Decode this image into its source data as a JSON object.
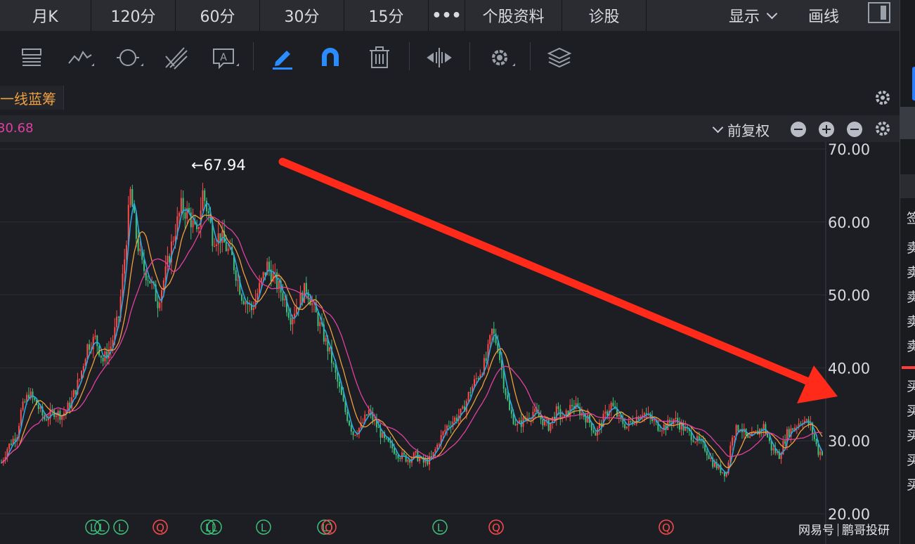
{
  "tabs": [
    "月K",
    "120分",
    "60分",
    "30分",
    "15分",
    "•••",
    "个股资料",
    "诊股"
  ],
  "display_label": "显示",
  "draw_label": "画线",
  "strategy_label": "一线蓝筹",
  "ma_value": "30.68",
  "price_adjust_label": "前复权",
  "peak_label": "←67.94",
  "watermark": {
    "brand": "网易号",
    "author": "鹏哥投研"
  },
  "edge_chars": [
    "签",
    "卖",
    "卖",
    "卖",
    "卖",
    "卖",
    "买",
    "买",
    "买",
    "买",
    "买"
  ],
  "colors": {
    "up": "#ff4a4a",
    "down": "#3fc07a",
    "ma5": "#29a8e0",
    "ma10": "#f0a040",
    "ma20": "#e040a0",
    "arrow": "#ff2a1a",
    "marker_q": "#ff4a4a",
    "marker_l": "#3fc07a"
  },
  "icons": [
    "text-list-icon",
    "polyline-icon",
    "cycle-icon",
    "fork-icon",
    "note-icon",
    "pencil-icon",
    "magnet-icon",
    "trash-icon",
    "split-icon",
    "settings-icon",
    "layers-icon"
  ],
  "chart_data": {
    "type": "candlestick",
    "ylim": [
      20,
      70
    ],
    "y_ticks": [
      "70.00",
      "60.00",
      "50.00",
      "40.00",
      "30.00",
      "20.00"
    ],
    "series": [
      {
        "name": "price",
        "points": [
          [
            0,
            27
          ],
          [
            3,
            29
          ],
          [
            8,
            31
          ],
          [
            10,
            34
          ],
          [
            14,
            36.5
          ],
          [
            18,
            35
          ],
          [
            22,
            33
          ],
          [
            27,
            34
          ],
          [
            31,
            33.5
          ],
          [
            35,
            35
          ],
          [
            40,
            38.5
          ],
          [
            44,
            43
          ],
          [
            48,
            44
          ],
          [
            52,
            41
          ],
          [
            56,
            43
          ],
          [
            60,
            47
          ],
          [
            63,
            55
          ],
          [
            66,
            64
          ],
          [
            69,
            58
          ],
          [
            72,
            54
          ],
          [
            76,
            52
          ],
          [
            80,
            49
          ],
          [
            84,
            53
          ],
          [
            88,
            58
          ],
          [
            92,
            62
          ],
          [
            96,
            61
          ],
          [
            100,
            58
          ],
          [
            103,
            64
          ],
          [
            106,
            61
          ],
          [
            108,
            58
          ],
          [
            112,
            58
          ],
          [
            118,
            55
          ],
          [
            123,
            50
          ],
          [
            128,
            48
          ],
          [
            132,
            51
          ],
          [
            136,
            54
          ],
          [
            140,
            52
          ],
          [
            144,
            50
          ],
          [
            148,
            47
          ],
          [
            152,
            49
          ],
          [
            156,
            51
          ],
          [
            160,
            48
          ],
          [
            164,
            45
          ],
          [
            168,
            42
          ],
          [
            172,
            38
          ],
          [
            176,
            34
          ],
          [
            180,
            31
          ],
          [
            184,
            32
          ],
          [
            188,
            34
          ],
          [
            192,
            32
          ],
          [
            196,
            30
          ],
          [
            200,
            29
          ],
          [
            204,
            28
          ],
          [
            208,
            27.5
          ],
          [
            212,
            28
          ],
          [
            216,
            27
          ],
          [
            220,
            27.5
          ],
          [
            224,
            30
          ],
          [
            228,
            32
          ],
          [
            232,
            33
          ],
          [
            236,
            34
          ],
          [
            240,
            37
          ],
          [
            244,
            39
          ],
          [
            248,
            41
          ],
          [
            251,
            45
          ],
          [
            254,
            43
          ],
          [
            257,
            38
          ],
          [
            260,
            34
          ],
          [
            264,
            32
          ],
          [
            268,
            33
          ],
          [
            272,
            34
          ],
          [
            276,
            33
          ],
          [
            280,
            32
          ],
          [
            284,
            34
          ],
          [
            288,
            33
          ],
          [
            292,
            35
          ],
          [
            296,
            34
          ],
          [
            300,
            33
          ],
          [
            304,
            31
          ],
          [
            308,
            33
          ],
          [
            312,
            35
          ],
          [
            316,
            33
          ],
          [
            320,
            32
          ],
          [
            324,
            33
          ],
          [
            328,
            34
          ],
          [
            332,
            33
          ],
          [
            336,
            32
          ],
          [
            340,
            32
          ],
          [
            344,
            33
          ],
          [
            348,
            32
          ],
          [
            352,
            31
          ],
          [
            356,
            30
          ],
          [
            360,
            29
          ],
          [
            364,
            27
          ],
          [
            368,
            26
          ],
          [
            371,
            25.5
          ],
          [
            374,
            31
          ],
          [
            378,
            32
          ],
          [
            382,
            30
          ],
          [
            386,
            31
          ],
          [
            390,
            32
          ],
          [
            394,
            29
          ],
          [
            398,
            28
          ],
          [
            402,
            31
          ],
          [
            406,
            32
          ],
          [
            410,
            33
          ],
          [
            414,
            32
          ],
          [
            418,
            28.5
          ],
          [
            420,
            28.5
          ]
        ]
      }
    ],
    "annotations": [
      "←67.94"
    ],
    "markers": [
      "L",
      "L",
      "L",
      "Q",
      "L",
      "L",
      "L",
      "L",
      "Q",
      "L",
      "Q",
      "Q"
    ]
  }
}
